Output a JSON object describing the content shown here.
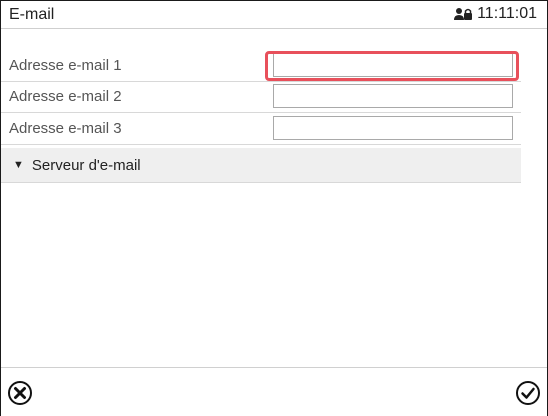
{
  "window": {
    "title": "E-mail",
    "time": "11:11:01"
  },
  "fields": [
    {
      "label": "Adresse e-mail 1",
      "value": "",
      "placeholder": ""
    },
    {
      "label": "Adresse e-mail 2",
      "value": "",
      "placeholder": ""
    },
    {
      "label": "Adresse e-mail 3",
      "value": "",
      "placeholder": ""
    }
  ],
  "section": {
    "label": "Serveur d'e-mail",
    "icon": "triangle-down-icon"
  },
  "footer": {
    "cancel_icon": "cancel-circle-x-icon",
    "confirm_icon": "confirm-check-icon"
  },
  "colors": {
    "highlight": "#e8505b"
  }
}
